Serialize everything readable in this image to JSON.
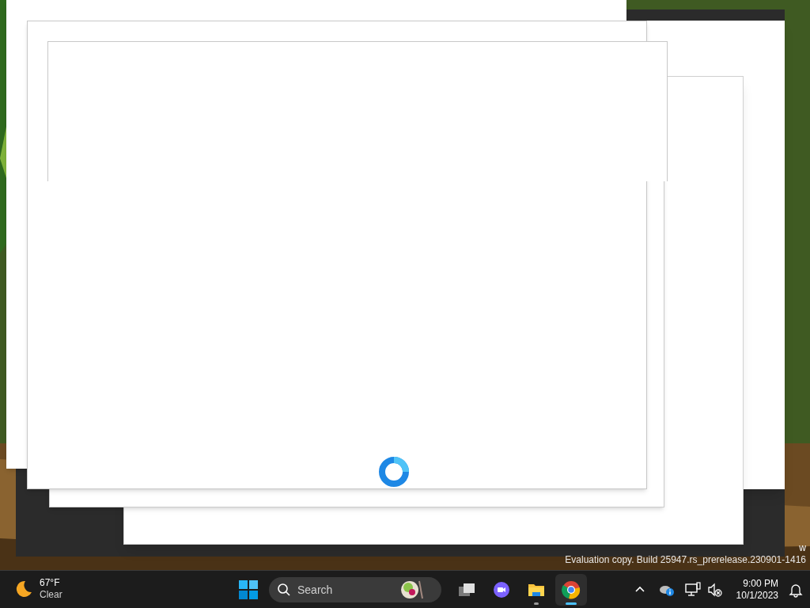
{
  "desktop": {
    "edge_text": "w",
    "watermark": "Evaluation copy. Build 25947.rs_prerelease.230901-1416"
  },
  "taskbar": {
    "weather": {
      "temperature": "67°F",
      "condition": "Clear"
    },
    "search": {
      "placeholder": "Search"
    },
    "apps": [
      {
        "kind": "task-view",
        "running": false,
        "selected": false
      },
      {
        "kind": "meet",
        "running": false,
        "selected": false
      },
      {
        "kind": "explorer",
        "running": true,
        "selected": false
      },
      {
        "kind": "chrome",
        "running": true,
        "selected": true
      }
    ],
    "clock": {
      "time": "9:00 PM",
      "date": "10/1/2023"
    }
  }
}
